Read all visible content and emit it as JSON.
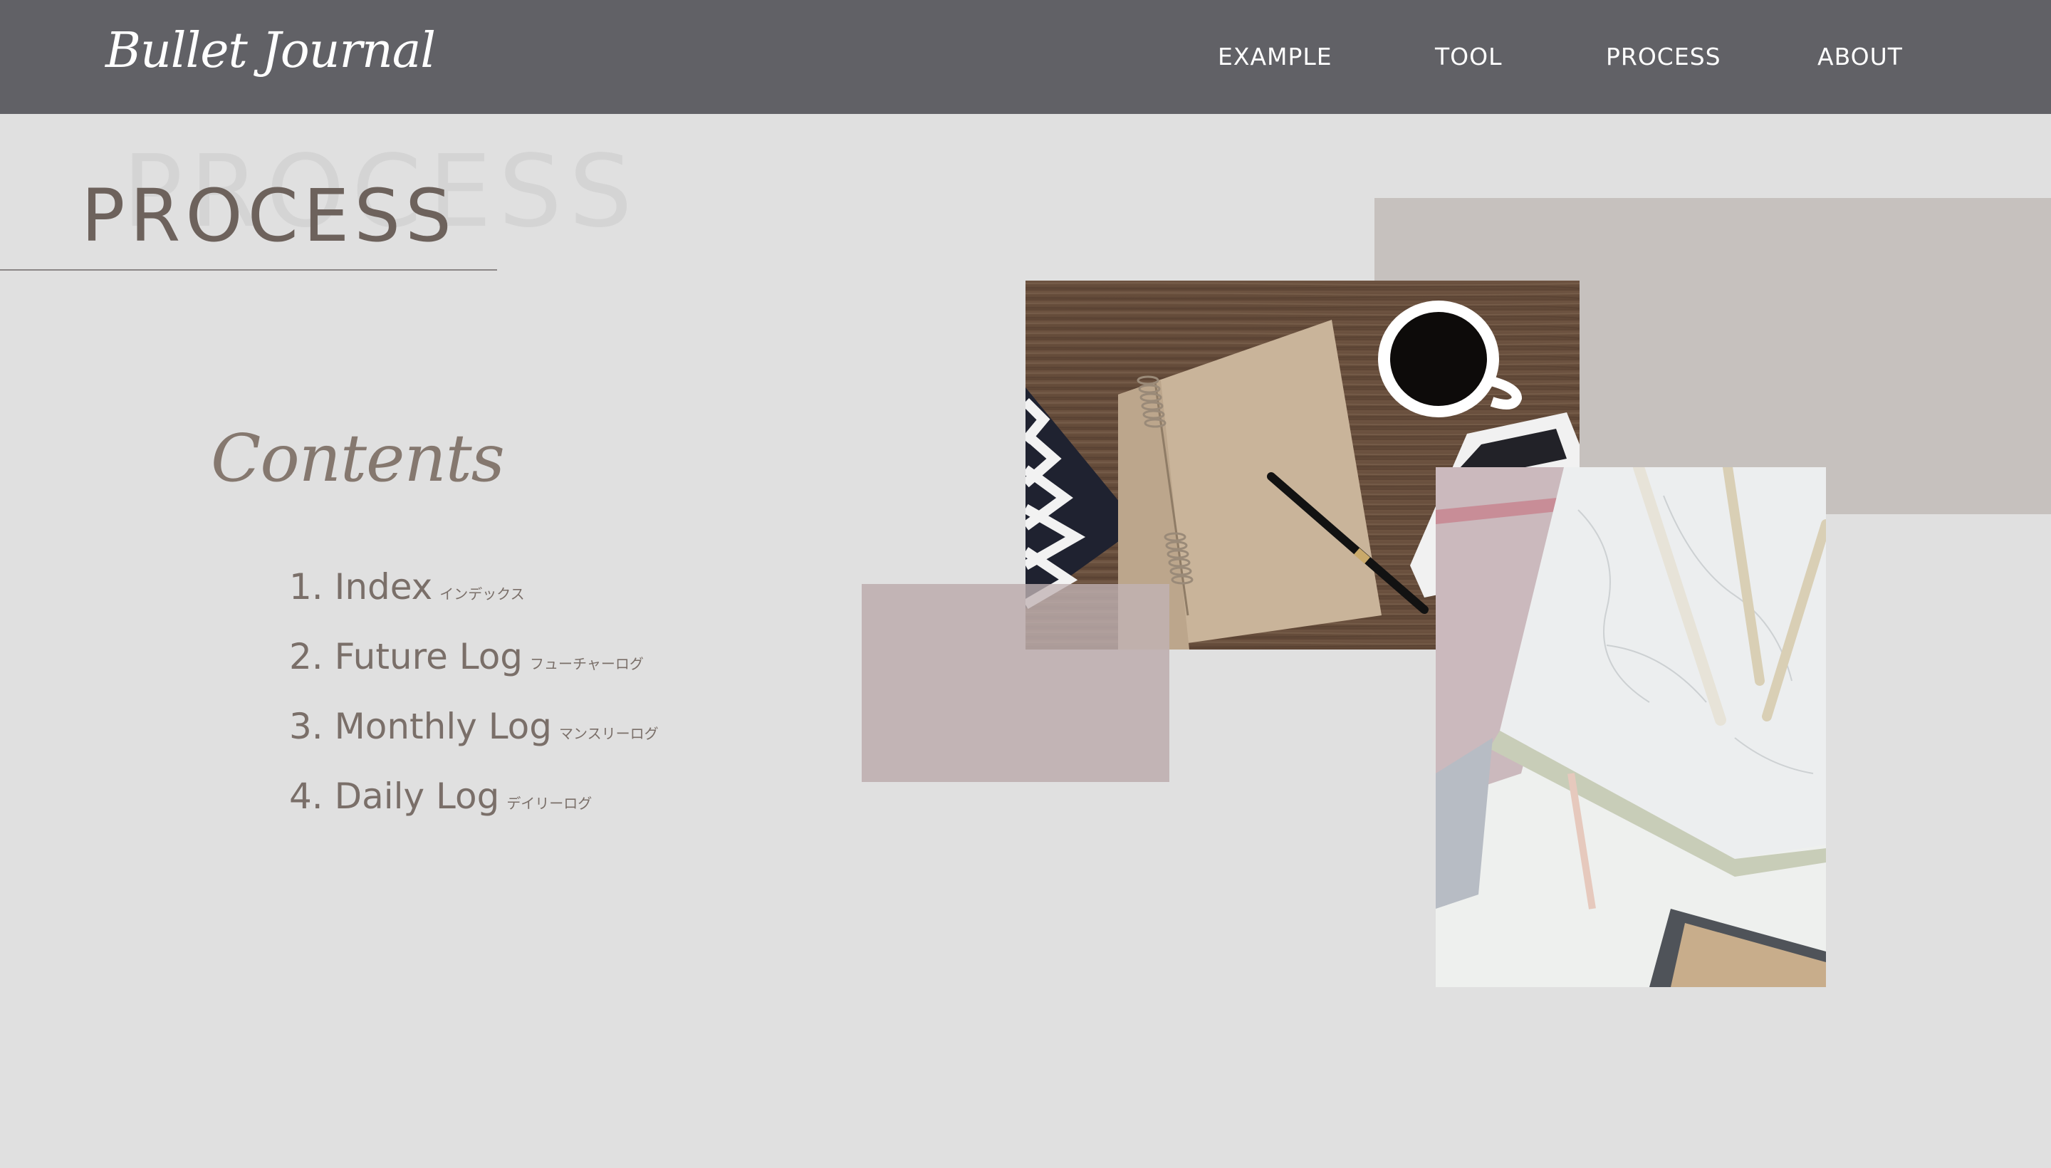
{
  "header": {
    "logo": "Bullet Journal",
    "nav": [
      {
        "label": "EXAMPLE"
      },
      {
        "label": "TOOL"
      },
      {
        "label": "PROCESS"
      },
      {
        "label": "ABOUT"
      }
    ]
  },
  "title": {
    "ghost": "PROCESS",
    "main": "PROCESS"
  },
  "contents": {
    "heading": "Contents",
    "items": [
      {
        "label": "1. Index",
        "sub": "インデックス"
      },
      {
        "label": "2. Future Log",
        "sub": "フューチャーログ"
      },
      {
        "label": "3. Monthly Log",
        "sub": "マンスリーログ"
      },
      {
        "label": "4. Daily Log",
        "sub": "デイリーログ"
      }
    ]
  },
  "colors": {
    "header_bg": "#616166",
    "page_bg": "#e0e0e0",
    "title_text": "#6d625c",
    "gray_block": "#c6c1be",
    "rose_block": "#c2b4b5"
  },
  "images": {
    "notebook_photo": "photo-notebook-coffee-pen",
    "marble_photo": "photo-marble-notebook-pencils"
  }
}
